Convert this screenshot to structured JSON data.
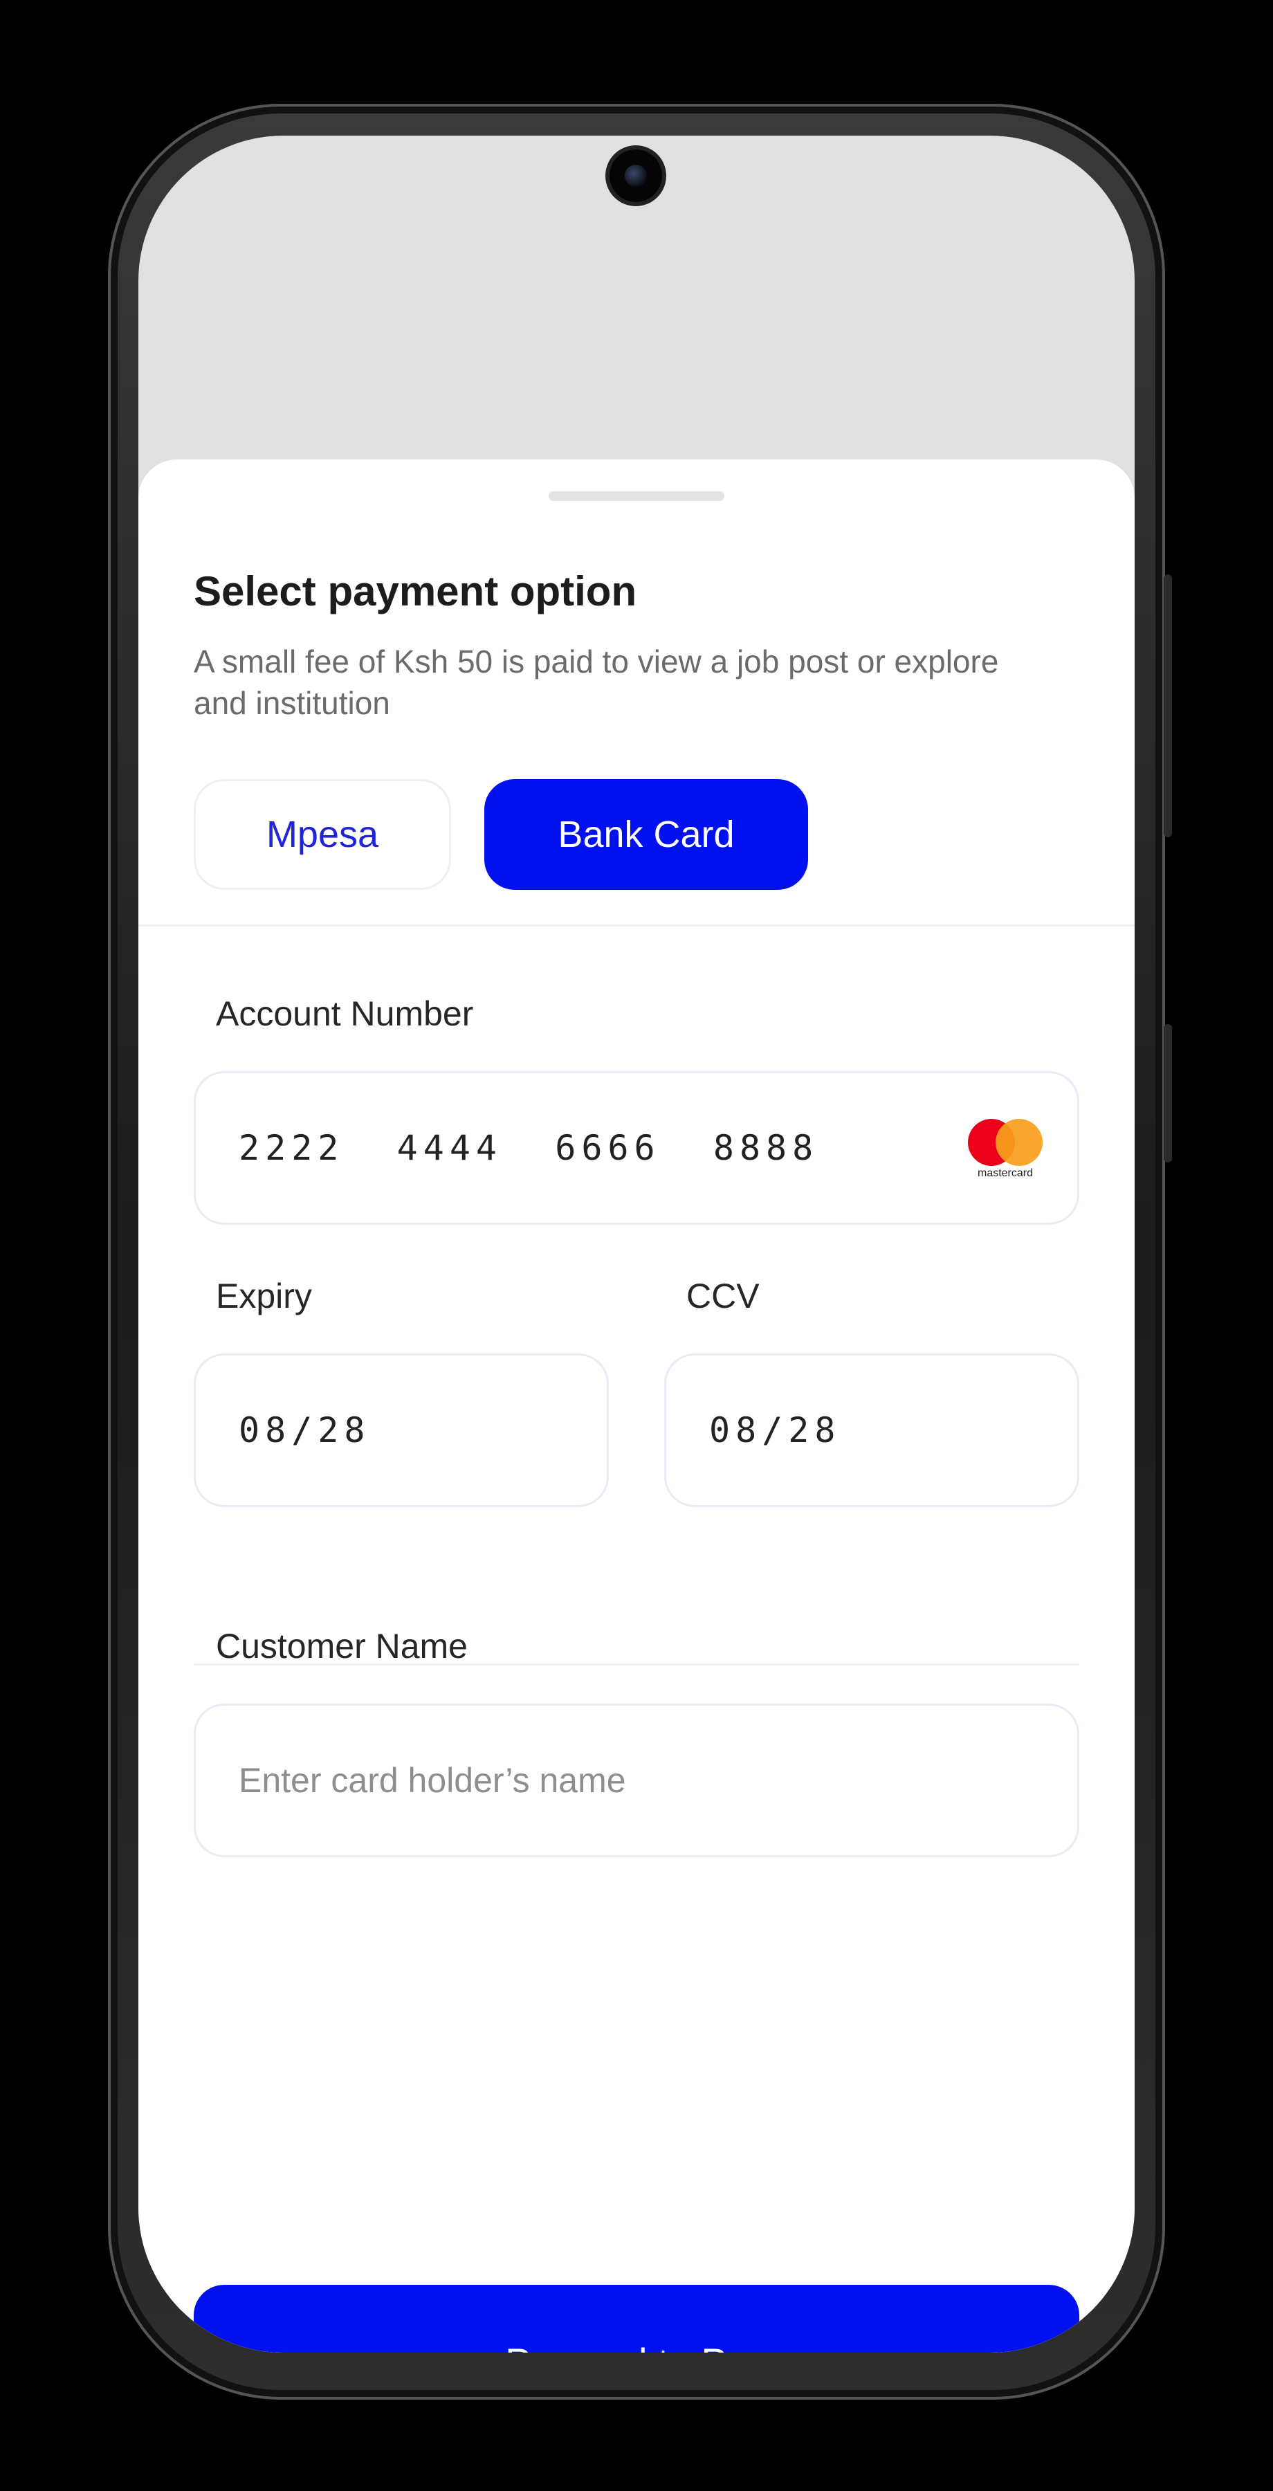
{
  "sheet": {
    "title": "Select payment option",
    "subtitle": "A small fee of Ksh 50 is paid to view a job post or explore and institution"
  },
  "tabs": [
    {
      "label": "Mpesa",
      "selected": false
    },
    {
      "label": "Bank Card",
      "selected": true
    }
  ],
  "card_form": {
    "account_number_label": "Account Number",
    "account_number_value": "2222  4444  6666  8888",
    "card_brand": "mastercard",
    "expiry_label": "Expiry",
    "expiry_value": "08/28",
    "ccv_label": "CCV",
    "ccv_value": "08/28",
    "customer_name_label": "Customer Name",
    "customer_name_placeholder": "Enter card holder’s name"
  },
  "actions": {
    "pay_label": "Procced to Pay"
  },
  "colors": {
    "accent": "#0010ee",
    "mastercard_red": "#eb001b",
    "mastercard_orange": "#f79e1b"
  },
  "icons": {
    "card_brand_icon": "mastercard-logo"
  }
}
